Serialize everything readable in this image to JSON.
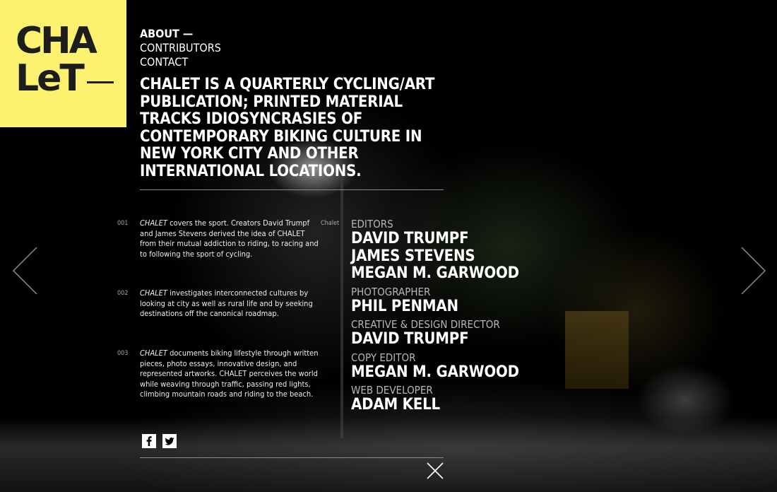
{
  "logo": {
    "line1": "CHA",
    "line2": "LeT"
  },
  "nav": {
    "items": [
      {
        "label": "ABOUT —"
      },
      {
        "label": "CONTRIBUTORS"
      },
      {
        "label": "CONTACT"
      }
    ]
  },
  "tagline": "CHALET IS A QUARTERLY CYCLING/ART PUBLICATION; PRINTED MATERIAL TRACKS IDIOSYNCRASIES OF CONTEMPORARY BIKING CULTURE IN NEW YORK CITY AND OTHER INTERNATIONAL LOCATIONS.",
  "sections": [
    {
      "num": "001",
      "em": "CHALET",
      "text": " covers the sport. Creators David Trumpf and James Stevens derived the idea of CHALET from their mutual addiction to riding, to racing and to following the sport of cycling."
    },
    {
      "num": "002",
      "em": "CHALET",
      "text": " investigates interconnected cultures by looking at city as well as rural life and by seeking destinations off the canonical roadmap."
    },
    {
      "num": "003",
      "em": "CHALET",
      "text": " documents biking lifestyle through written pieces, photo essays, innovative design, and represented artworks. CHALET perceives the world while weaving through traffic, passing red lights, climbing mountain roads and riding to the beach."
    }
  ],
  "side_label": "Chalet",
  "credits": [
    {
      "role": "EDITORS",
      "names": [
        "DAVID TRUMPF",
        "JAMES STEVENS",
        "MEGAN M. GARWOOD"
      ]
    },
    {
      "role": "PHOTOGRAPHER",
      "names": [
        "PHIL PENMAN"
      ]
    },
    {
      "role": "CREATIVE & DESIGN DIRECTOR",
      "names": [
        "DAVID TRUMPF"
      ]
    },
    {
      "role": "COPY EDITOR",
      "names": [
        "MEGAN M. GARWOOD"
      ]
    },
    {
      "role": "WEB DEVELOPER",
      "names": [
        "ADAM KELL"
      ]
    }
  ],
  "icons": {
    "facebook": "facebook-icon",
    "twitter": "twitter-icon",
    "prev": "chevron-left-icon",
    "next": "chevron-right-icon",
    "close": "close-icon"
  },
  "colors": {
    "logo_bg": "#fcf270",
    "logo_text": "#1d1d1b",
    "text": "#ffffff",
    "muted": "#b7b7b7"
  }
}
